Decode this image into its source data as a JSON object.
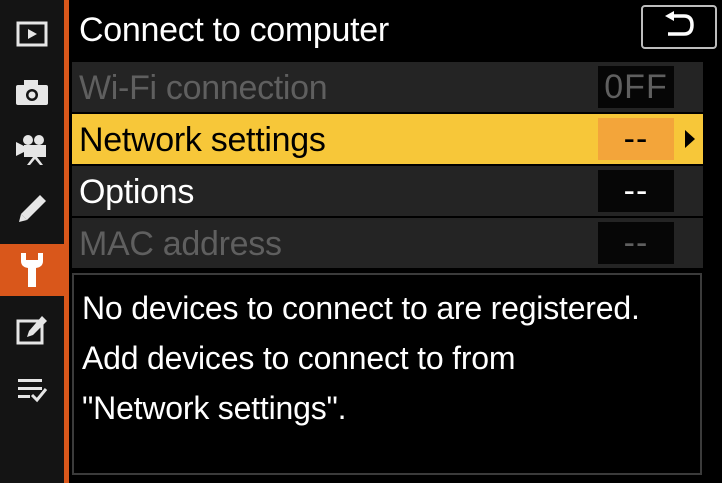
{
  "header": {
    "title": "Connect to computer",
    "back_icon": "return-arrow-icon"
  },
  "sidebar": {
    "tabs": [
      {
        "icon": "playback-icon",
        "active": false
      },
      {
        "icon": "camera-icon",
        "active": false
      },
      {
        "icon": "movie-camera-icon",
        "active": false
      },
      {
        "icon": "pencil-icon",
        "active": false
      },
      {
        "icon": "wrench-icon",
        "active": true
      },
      {
        "icon": "retouch-icon",
        "active": false
      },
      {
        "icon": "my-menu-icon",
        "active": false
      }
    ],
    "active_color": "#d9571b"
  },
  "menu": {
    "rows": [
      {
        "label": "Wi-Fi connection",
        "value": "0FF",
        "enabled": false,
        "selected": false
      },
      {
        "label": "Network settings",
        "value": "--",
        "enabled": true,
        "selected": true
      },
      {
        "label": "Options",
        "value": "--",
        "enabled": true,
        "selected": false
      },
      {
        "label": "MAC address",
        "value": "--",
        "enabled": false,
        "selected": false
      }
    ],
    "highlight_color": "#f7c739",
    "highlight_value_color": "#f3a53a"
  },
  "message": {
    "text": "No devices to connect to are registered. Add devices to connect to from \"Network settings\"."
  }
}
